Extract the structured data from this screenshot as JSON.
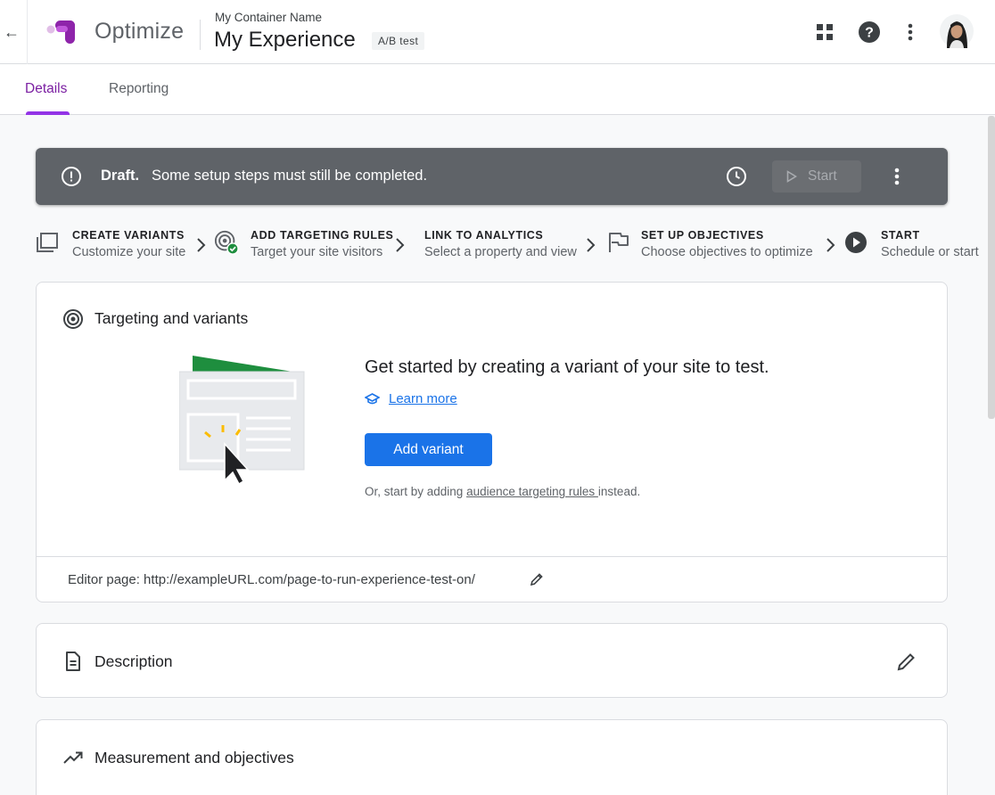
{
  "header": {
    "back_icon": "arrow-back-icon",
    "app_name": "Optimize",
    "container_name": "My Container Name",
    "experience_name": "My Experience",
    "experience_type": "A/B test",
    "icons": [
      "apps-grid-icon",
      "help-icon",
      "more-vert-icon",
      "avatar"
    ]
  },
  "tabs": [
    {
      "label": "Details",
      "active": true
    },
    {
      "label": "Reporting",
      "active": false
    }
  ],
  "banner": {
    "status": "Draft.",
    "message": "Some setup steps must still be completed.",
    "start_label": "Start",
    "background": "#5f6368"
  },
  "steps": [
    {
      "title": "CREATE VARIANTS",
      "subtitle": "Customize your site",
      "icon": "variants-icon"
    },
    {
      "title": "ADD TARGETING RULES",
      "subtitle": "Target your site visitors",
      "icon": "target-check-icon",
      "completed": true
    },
    {
      "title": "LINK TO ANALYTICS",
      "subtitle": "Select a property and view",
      "icon": "none"
    },
    {
      "title": "SET UP OBJECTIVES",
      "subtitle": "Choose objectives to optimize",
      "icon": "flag-icon"
    },
    {
      "title": "START",
      "subtitle": "Schedule or start",
      "icon": "play-circle-icon"
    }
  ],
  "targeting_card": {
    "title": "Targeting and variants",
    "headline": "Get started by creating a variant of your site to test.",
    "learn_more": "Learn more",
    "add_variant": "Add variant",
    "alt_prefix": "Or, start by adding ",
    "alt_link": "audience targeting rules ",
    "alt_suffix": "instead.",
    "editor_page": "Editor page: http://exampleURL.com/page-to-run-experience-test-on/"
  },
  "description_card": {
    "title": "Description"
  },
  "measurement_card": {
    "title": "Measurement and objectives"
  },
  "colors": {
    "accent": "#9334e6",
    "primary_button": "#1a73e8",
    "link": "#1a73e8",
    "success": "#1e8e3e"
  }
}
